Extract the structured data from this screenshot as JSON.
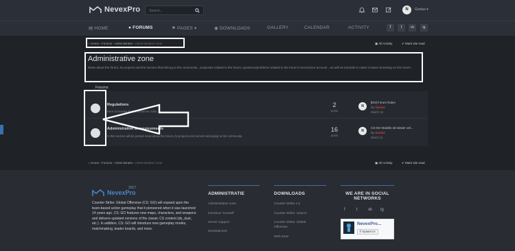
{
  "header": {
    "brand": "NevexPro",
    "search_placeholder": "Search...",
    "username": "Genius",
    "avatar_letter": "N"
  },
  "nav": {
    "items": [
      {
        "label": "HOME"
      },
      {
        "label": "FORUMS"
      },
      {
        "label": "PAGES"
      },
      {
        "label": "DOWNLOADS"
      },
      {
        "label": "GALLERY"
      },
      {
        "label": "CALENDAR"
      },
      {
        "label": "ACTIVITY"
      }
    ],
    "social": [
      "f",
      "t",
      "vk",
      "ig"
    ]
  },
  "breadcrumb": {
    "items": [
      "Home",
      "Forums",
      "Administratie",
      "Administrative zone"
    ],
    "all_activity": "All Activity",
    "mark_read": "Mark site read"
  },
  "page": {
    "title": "Administrative zone",
    "description": "News about the forum, its projects and the servers that belong to the community , proposals related to the forum; questions/problems related to the forum's server/your account , as well as tutorials to make it easier browsing on this forum.",
    "forums_label": "Forums"
  },
  "forums": [
    {
      "title": "Regulations",
      "description": "Here to browse the forum/server rules.",
      "count": "2",
      "count_label": "posts",
      "last_title": "[EN] Forum Rules",
      "last_by": "By",
      "last_user": "Genius",
      "last_date": "March 16"
    },
    {
      "title": "Administrative announcements",
      "description": "In this section will be posted news about the forum, its projects and servers belonging to the community.",
      "count": "16",
      "count_label": "posts",
      "last_title": "CS:GO Models 3d viewer onl...",
      "last_by": "By",
      "last_user": "Genius",
      "last_date": "March 11"
    }
  ],
  "footer": {
    "brand": "NevexPro",
    "year": "2017",
    "about": "Counter-Strike: Global Offensive (CS: GO) will expand upon the team-based action gameplay that it pioneered when it was launched 14 years ago. CS: GO features new maps, characters, and weapons and delivers updated versions of the classic CS content (de_dust, etc.). In addition, CS: GO will introduce new gameplay modes, matchmaking, leader boards, and more.",
    "col1": {
      "heading": "ADMINISTRATIE",
      "links": [
        "Administrative zone",
        "Introduce Yourself",
        "Server support",
        "Development"
      ]
    },
    "col2": {
      "heading": "DOWNLOADS",
      "links": [
        "Counter-Strike 1.6",
        "Counter-Strike: Source",
        "Counter-Strike: Global",
        "Offensive",
        "Web Zone"
      ]
    },
    "col3": {
      "heading_line1": "WE ARE IN SOCIAL",
      "heading_line2": "NETWORKS",
      "fb_title": "NevexPro...",
      "fb_button": "Нравится"
    }
  },
  "colors": {
    "accent": "#3f6ea8",
    "username_red": "#e0383e"
  }
}
